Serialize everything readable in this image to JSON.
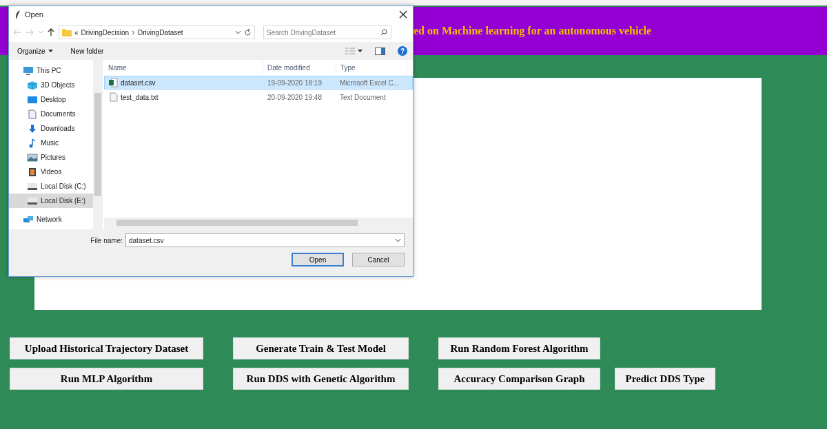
{
  "app": {
    "heading": "ed on Machine learning for an autonomous vehicle",
    "buttons": [
      [
        "Upload Historical Trajectory Dataset",
        "Generate Train & Test Model",
        "Run Random Forest Algorithm"
      ],
      [
        "Run MLP Algorithm",
        "Run DDS with Genetic Algorithm",
        "Accuracy Comparison Graph",
        "Predict DDS Type"
      ]
    ]
  },
  "dialog": {
    "title": "Open",
    "path_prefix": "«",
    "path": [
      "DrivingDecision",
      "DrivingDataset"
    ],
    "search": {
      "placeholder": "Search DrivingDataset"
    },
    "toolbar": {
      "organize": "Organize",
      "new_folder": "New folder",
      "help": "?"
    },
    "sidebar": {
      "items": [
        {
          "label": "This PC",
          "kind": "pc",
          "selected": false
        },
        {
          "label": "3D Objects",
          "kind": "cube",
          "selected": false
        },
        {
          "label": "Desktop",
          "kind": "desktop",
          "selected": false
        },
        {
          "label": "Documents",
          "kind": "doc",
          "selected": false
        },
        {
          "label": "Downloads",
          "kind": "download",
          "selected": false
        },
        {
          "label": "Music",
          "kind": "music",
          "selected": false
        },
        {
          "label": "Pictures",
          "kind": "pictures",
          "selected": false
        },
        {
          "label": "Videos",
          "kind": "videos",
          "selected": false
        },
        {
          "label": "Local Disk (C:)",
          "kind": "disk",
          "selected": false
        },
        {
          "label": "Local Disk (E:)",
          "kind": "disk",
          "selected": true
        },
        {
          "label": "Network",
          "kind": "network",
          "selected": false
        }
      ]
    },
    "columns": [
      "Name",
      "Date modified",
      "Type"
    ],
    "files": [
      {
        "name": "dataset.csv",
        "date": "19-09-2020 18:19",
        "type": "Microsoft Excel C...",
        "kind": "excel",
        "selected": true
      },
      {
        "name": "test_data.txt",
        "date": "20-09-2020 19:48",
        "type": "Text Document",
        "kind": "text",
        "selected": false
      }
    ],
    "file_name": {
      "label": "File name:",
      "value": "dataset.csv"
    },
    "buttons": [
      "Open",
      "Cancel"
    ]
  }
}
